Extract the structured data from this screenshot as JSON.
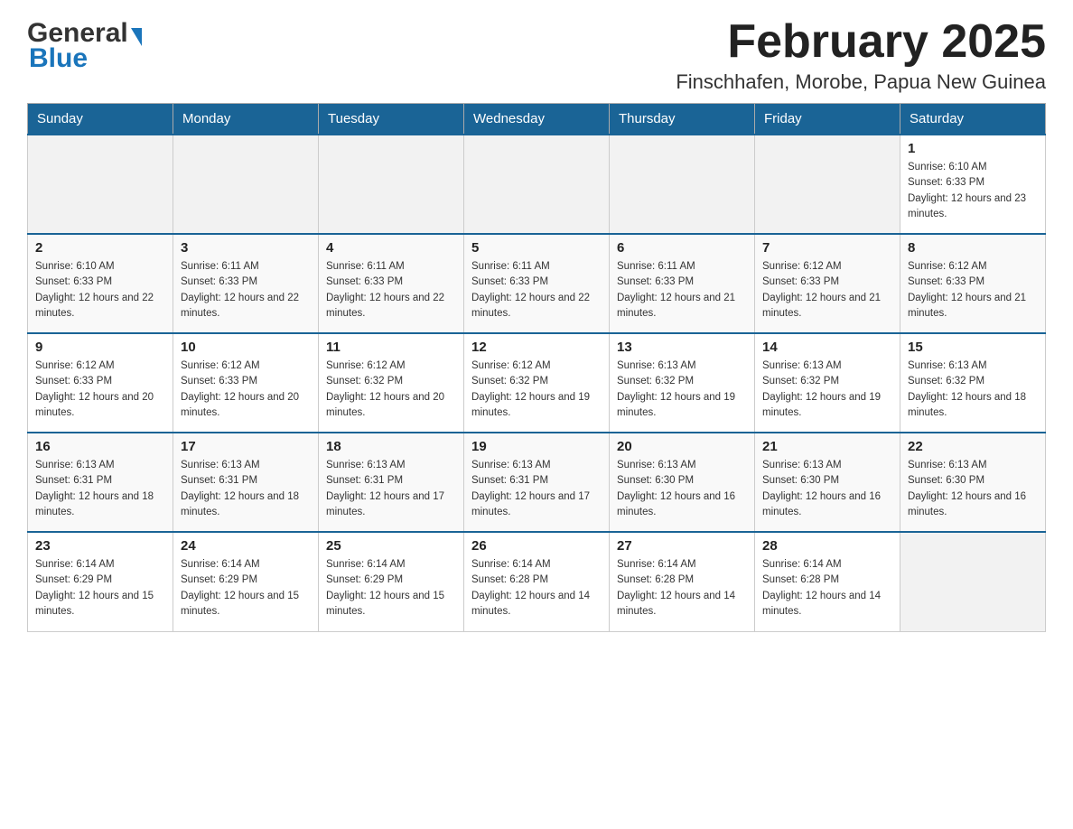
{
  "header": {
    "logo_general": "General",
    "logo_blue": "Blue",
    "month": "February 2025",
    "location": "Finschhafen, Morobe, Papua New Guinea"
  },
  "days_of_week": [
    "Sunday",
    "Monday",
    "Tuesday",
    "Wednesday",
    "Thursday",
    "Friday",
    "Saturday"
  ],
  "weeks": [
    [
      {
        "day": "",
        "sunrise": "",
        "sunset": "",
        "daylight": ""
      },
      {
        "day": "",
        "sunrise": "",
        "sunset": "",
        "daylight": ""
      },
      {
        "day": "",
        "sunrise": "",
        "sunset": "",
        "daylight": ""
      },
      {
        "day": "",
        "sunrise": "",
        "sunset": "",
        "daylight": ""
      },
      {
        "day": "",
        "sunrise": "",
        "sunset": "",
        "daylight": ""
      },
      {
        "day": "",
        "sunrise": "",
        "sunset": "",
        "daylight": ""
      },
      {
        "day": "1",
        "sunrise": "Sunrise: 6:10 AM",
        "sunset": "Sunset: 6:33 PM",
        "daylight": "Daylight: 12 hours and 23 minutes."
      }
    ],
    [
      {
        "day": "2",
        "sunrise": "Sunrise: 6:10 AM",
        "sunset": "Sunset: 6:33 PM",
        "daylight": "Daylight: 12 hours and 22 minutes."
      },
      {
        "day": "3",
        "sunrise": "Sunrise: 6:11 AM",
        "sunset": "Sunset: 6:33 PM",
        "daylight": "Daylight: 12 hours and 22 minutes."
      },
      {
        "day": "4",
        "sunrise": "Sunrise: 6:11 AM",
        "sunset": "Sunset: 6:33 PM",
        "daylight": "Daylight: 12 hours and 22 minutes."
      },
      {
        "day": "5",
        "sunrise": "Sunrise: 6:11 AM",
        "sunset": "Sunset: 6:33 PM",
        "daylight": "Daylight: 12 hours and 22 minutes."
      },
      {
        "day": "6",
        "sunrise": "Sunrise: 6:11 AM",
        "sunset": "Sunset: 6:33 PM",
        "daylight": "Daylight: 12 hours and 21 minutes."
      },
      {
        "day": "7",
        "sunrise": "Sunrise: 6:12 AM",
        "sunset": "Sunset: 6:33 PM",
        "daylight": "Daylight: 12 hours and 21 minutes."
      },
      {
        "day": "8",
        "sunrise": "Sunrise: 6:12 AM",
        "sunset": "Sunset: 6:33 PM",
        "daylight": "Daylight: 12 hours and 21 minutes."
      }
    ],
    [
      {
        "day": "9",
        "sunrise": "Sunrise: 6:12 AM",
        "sunset": "Sunset: 6:33 PM",
        "daylight": "Daylight: 12 hours and 20 minutes."
      },
      {
        "day": "10",
        "sunrise": "Sunrise: 6:12 AM",
        "sunset": "Sunset: 6:33 PM",
        "daylight": "Daylight: 12 hours and 20 minutes."
      },
      {
        "day": "11",
        "sunrise": "Sunrise: 6:12 AM",
        "sunset": "Sunset: 6:32 PM",
        "daylight": "Daylight: 12 hours and 20 minutes."
      },
      {
        "day": "12",
        "sunrise": "Sunrise: 6:12 AM",
        "sunset": "Sunset: 6:32 PM",
        "daylight": "Daylight: 12 hours and 19 minutes."
      },
      {
        "day": "13",
        "sunrise": "Sunrise: 6:13 AM",
        "sunset": "Sunset: 6:32 PM",
        "daylight": "Daylight: 12 hours and 19 minutes."
      },
      {
        "day": "14",
        "sunrise": "Sunrise: 6:13 AM",
        "sunset": "Sunset: 6:32 PM",
        "daylight": "Daylight: 12 hours and 19 minutes."
      },
      {
        "day": "15",
        "sunrise": "Sunrise: 6:13 AM",
        "sunset": "Sunset: 6:32 PM",
        "daylight": "Daylight: 12 hours and 18 minutes."
      }
    ],
    [
      {
        "day": "16",
        "sunrise": "Sunrise: 6:13 AM",
        "sunset": "Sunset: 6:31 PM",
        "daylight": "Daylight: 12 hours and 18 minutes."
      },
      {
        "day": "17",
        "sunrise": "Sunrise: 6:13 AM",
        "sunset": "Sunset: 6:31 PM",
        "daylight": "Daylight: 12 hours and 18 minutes."
      },
      {
        "day": "18",
        "sunrise": "Sunrise: 6:13 AM",
        "sunset": "Sunset: 6:31 PM",
        "daylight": "Daylight: 12 hours and 17 minutes."
      },
      {
        "day": "19",
        "sunrise": "Sunrise: 6:13 AM",
        "sunset": "Sunset: 6:31 PM",
        "daylight": "Daylight: 12 hours and 17 minutes."
      },
      {
        "day": "20",
        "sunrise": "Sunrise: 6:13 AM",
        "sunset": "Sunset: 6:30 PM",
        "daylight": "Daylight: 12 hours and 16 minutes."
      },
      {
        "day": "21",
        "sunrise": "Sunrise: 6:13 AM",
        "sunset": "Sunset: 6:30 PM",
        "daylight": "Daylight: 12 hours and 16 minutes."
      },
      {
        "day": "22",
        "sunrise": "Sunrise: 6:13 AM",
        "sunset": "Sunset: 6:30 PM",
        "daylight": "Daylight: 12 hours and 16 minutes."
      }
    ],
    [
      {
        "day": "23",
        "sunrise": "Sunrise: 6:14 AM",
        "sunset": "Sunset: 6:29 PM",
        "daylight": "Daylight: 12 hours and 15 minutes."
      },
      {
        "day": "24",
        "sunrise": "Sunrise: 6:14 AM",
        "sunset": "Sunset: 6:29 PM",
        "daylight": "Daylight: 12 hours and 15 minutes."
      },
      {
        "day": "25",
        "sunrise": "Sunrise: 6:14 AM",
        "sunset": "Sunset: 6:29 PM",
        "daylight": "Daylight: 12 hours and 15 minutes."
      },
      {
        "day": "26",
        "sunrise": "Sunrise: 6:14 AM",
        "sunset": "Sunset: 6:28 PM",
        "daylight": "Daylight: 12 hours and 14 minutes."
      },
      {
        "day": "27",
        "sunrise": "Sunrise: 6:14 AM",
        "sunset": "Sunset: 6:28 PM",
        "daylight": "Daylight: 12 hours and 14 minutes."
      },
      {
        "day": "28",
        "sunrise": "Sunrise: 6:14 AM",
        "sunset": "Sunset: 6:28 PM",
        "daylight": "Daylight: 12 hours and 14 minutes."
      },
      {
        "day": "",
        "sunrise": "",
        "sunset": "",
        "daylight": ""
      }
    ]
  ]
}
